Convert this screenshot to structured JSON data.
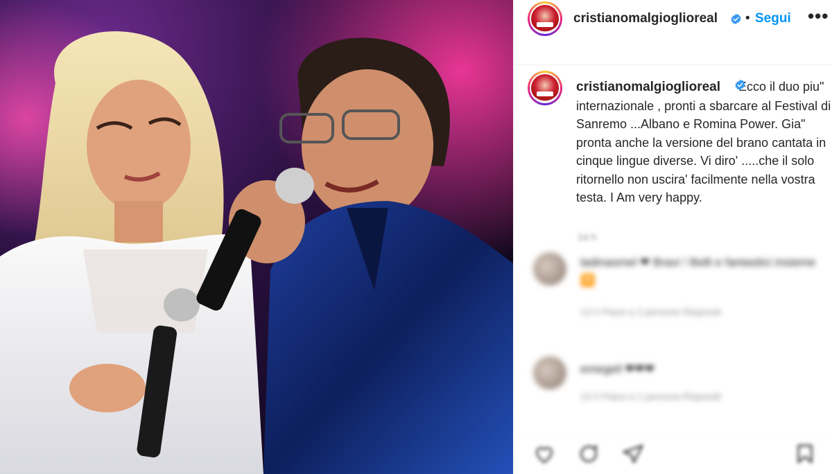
{
  "post": {
    "username": "cristianomalgioglioreal",
    "follow_label": "Segui",
    "dot": "•",
    "more_label": "•••",
    "caption": "Ecco il duo piu\" internazionale , pronti a sbarcare al Festival di Sanremo ...Albano e Romina Power. Gia\" pronta anche la versione del brano cantata in cinque lingue diverse. Vi diro' .....che il solo ritornello non uscira' facilmente nella vostra testa. I Am very happy."
  },
  "comments": [
    {
      "text": "ladinasmel ❤ Bravi ! Belli e fantastici insieme 🔽",
      "meta": "13 h   Piace a 2 persone   Rispondi",
      "time": "14 h"
    },
    {
      "text": "emegell ❤❤❤",
      "meta": "13 h   Piace a 1 persona   Rispondi"
    }
  ],
  "colors": {
    "follow": "#0095f6",
    "verified": "#3897f0",
    "heart": "#ed4956"
  },
  "icons": [
    "verified-icon",
    "more-options-icon",
    "heart-icon",
    "comment-icon",
    "share-icon",
    "save-icon"
  ]
}
